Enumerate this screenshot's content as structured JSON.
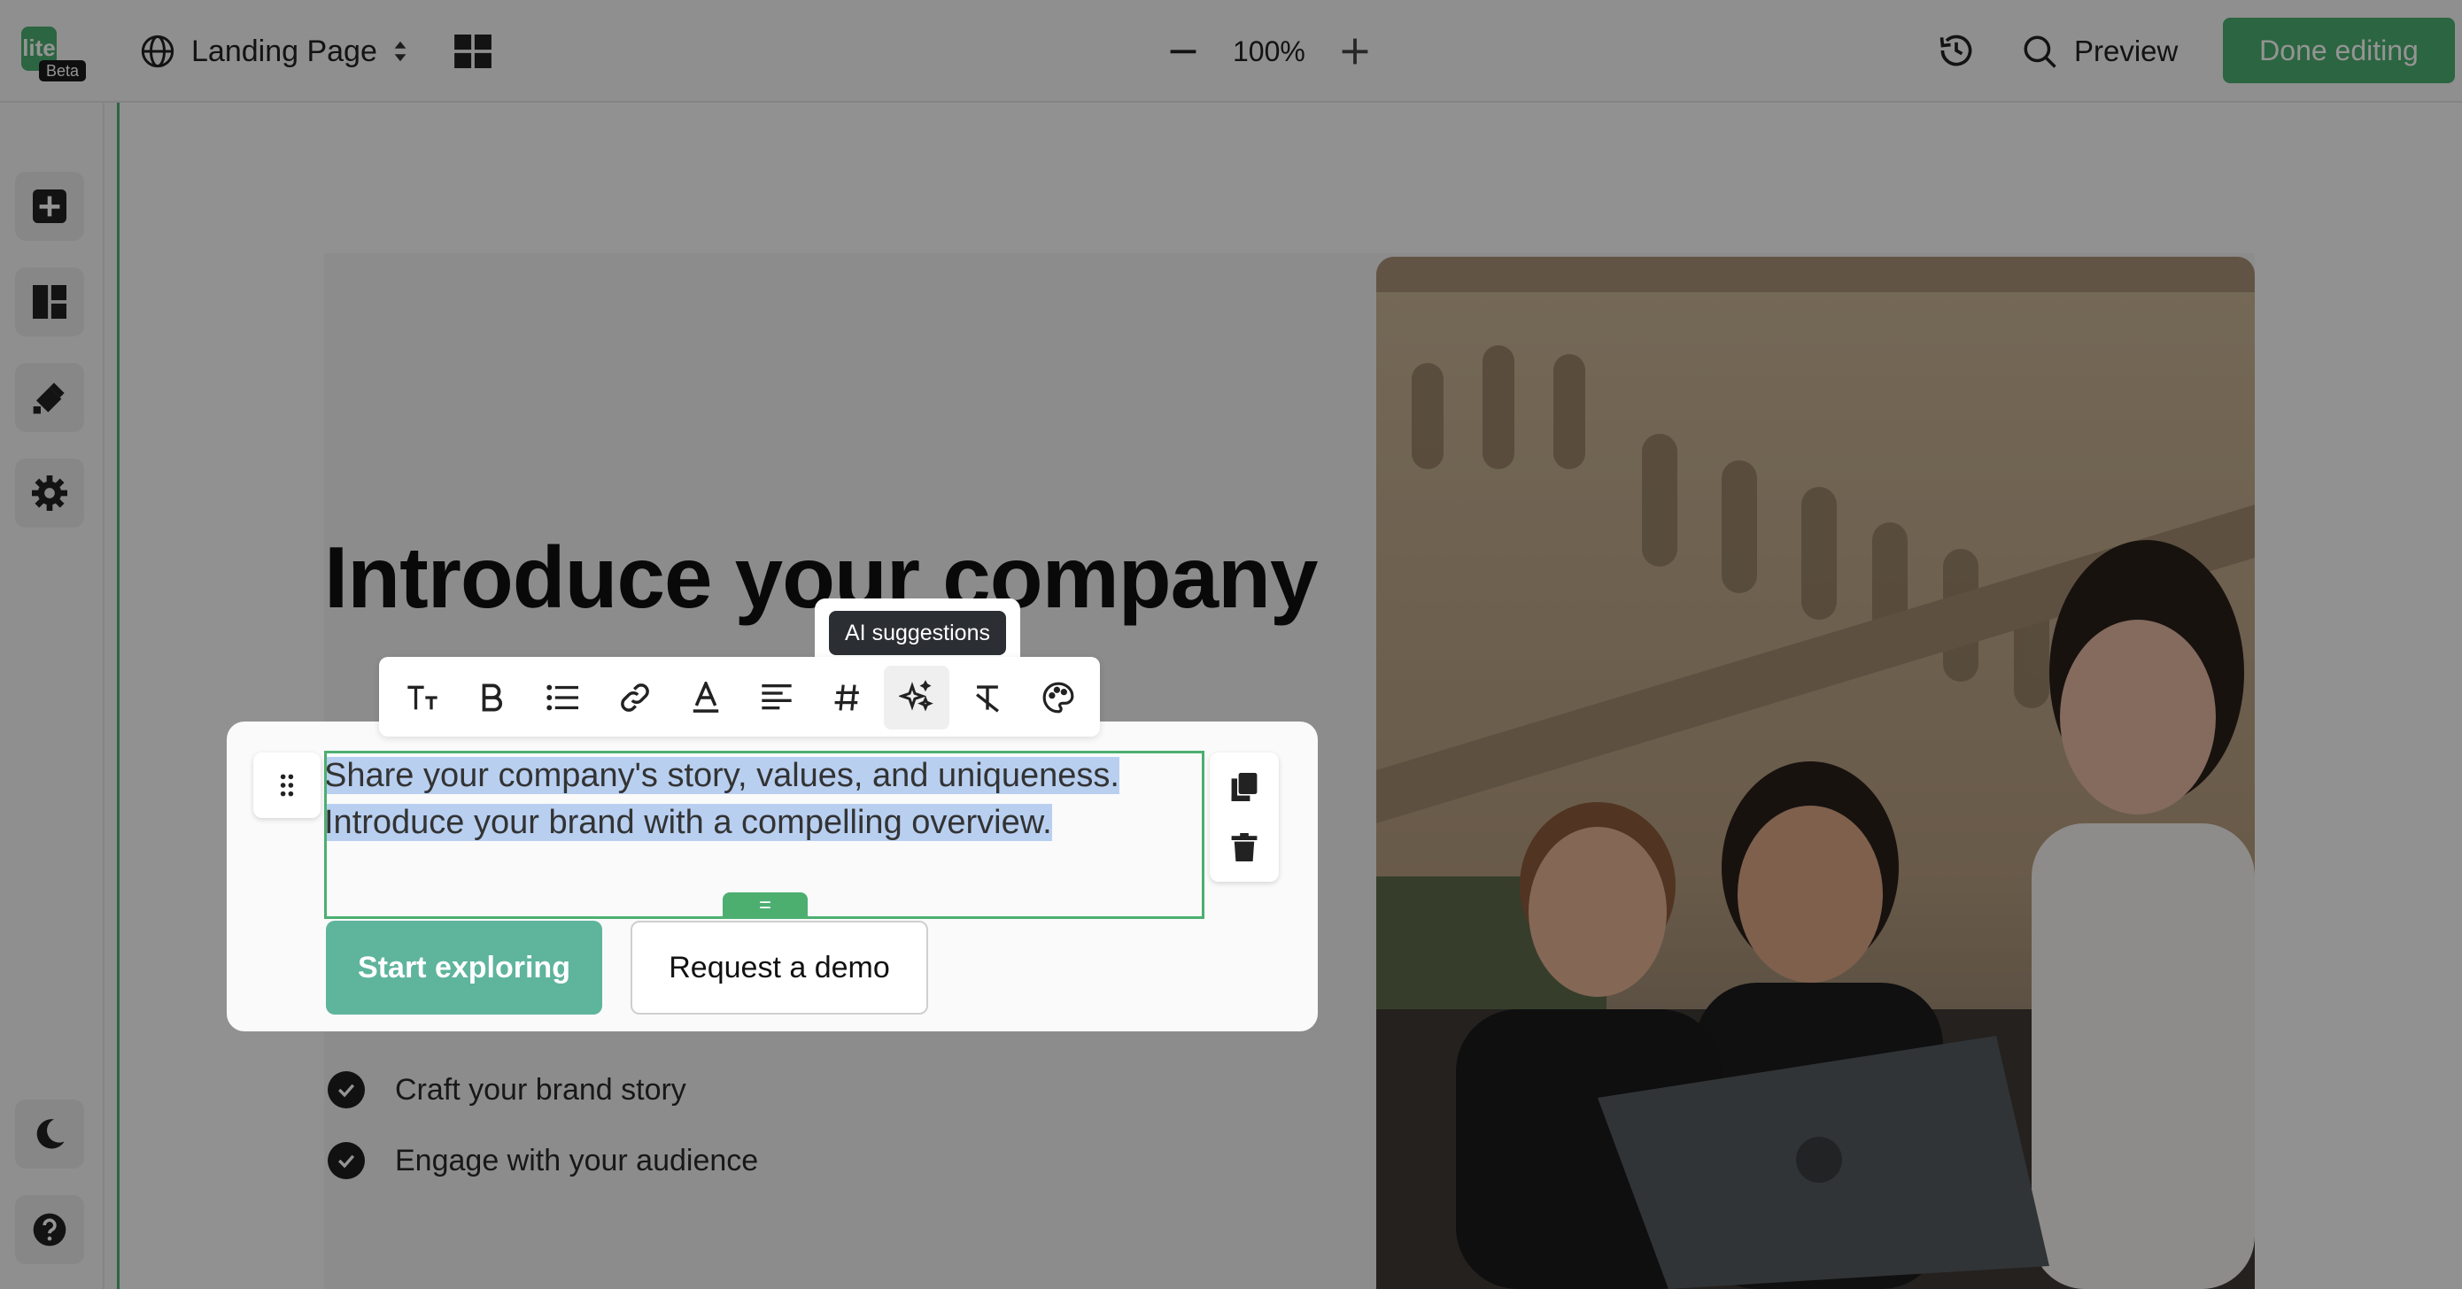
{
  "app": {
    "logo_text": "lite",
    "logo_badge": "Beta"
  },
  "header": {
    "page_selector": "Landing Page",
    "zoom_level": "100%",
    "preview_label": "Preview",
    "done_label": "Done editing"
  },
  "hero": {
    "headline": "Introduce your company",
    "body_line1": "Share your company's story, values, and uniqueness.",
    "body_line2": "Introduce your brand with a compelling overview.",
    "primary_cta": "Start exploring",
    "secondary_cta": "Request a demo",
    "checklist": [
      "Craft your brand story",
      "Engage with your audience"
    ]
  },
  "toolbar": {
    "tooltip": "AI suggestions"
  },
  "colors": {
    "brand": "#4caf70",
    "cta": "#5fb49c",
    "selection": "#b8cff0"
  }
}
